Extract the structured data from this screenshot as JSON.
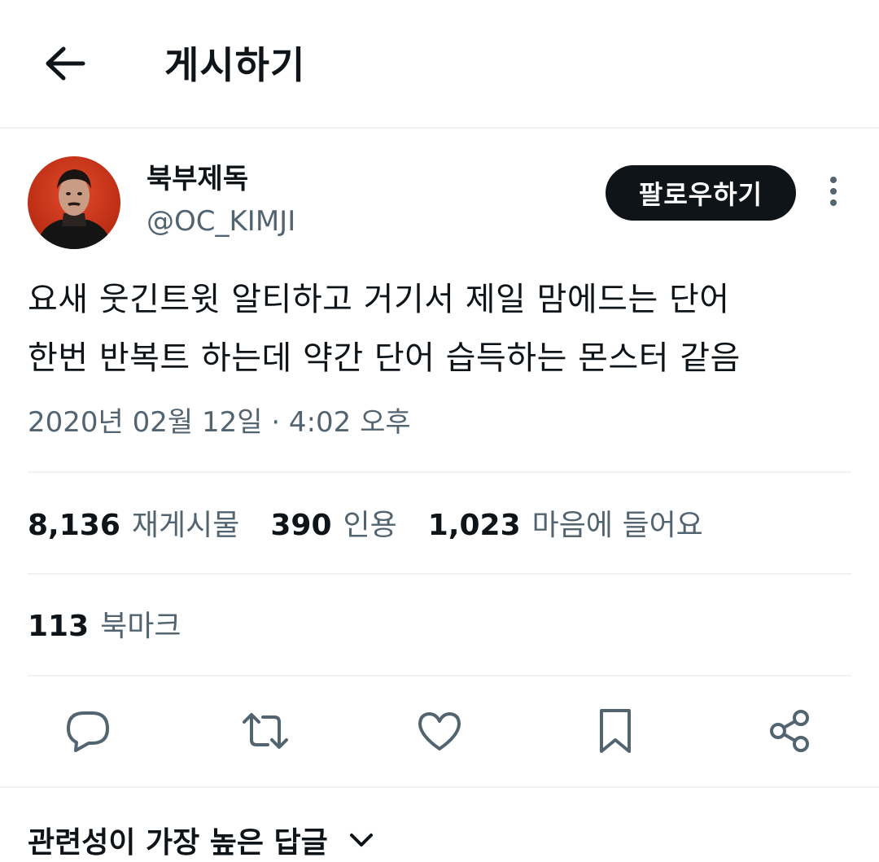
{
  "header": {
    "title": "게시하기",
    "back_icon": "arrow-left-icon"
  },
  "author": {
    "display_name": "북부제독",
    "handle": "@OC_KIMJI",
    "follow_label": "팔로우하기",
    "more_icon": "more-vertical-icon"
  },
  "tweet": {
    "lines": [
      "요새 웃긴트윗 알티하고 거기서 제일 맘에드는 단어",
      "한번 반복트 하는데 약간 단어 습득하는 몬스터 같음"
    ],
    "timestamp": "2020년 02월 12일 · 4:02 오후"
  },
  "stats": {
    "retweets": {
      "count": "8,136",
      "label": "재게시물"
    },
    "quotes": {
      "count": "390",
      "label": "인용"
    },
    "likes": {
      "count": "1,023",
      "label": "마음에 들어요"
    },
    "bookmarks": {
      "count": "113",
      "label": "북마크"
    }
  },
  "actions": [
    "reply-icon",
    "retweet-icon",
    "like-icon",
    "bookmark-icon",
    "share-icon"
  ],
  "replies": {
    "sort_label": "관련성이 가장 높은 답글"
  },
  "colors": {
    "text_primary": "#0f1419",
    "text_secondary": "#536471",
    "divider": "#eff3f4",
    "follow_bg": "#0f1419",
    "follow_text": "#ffffff"
  }
}
